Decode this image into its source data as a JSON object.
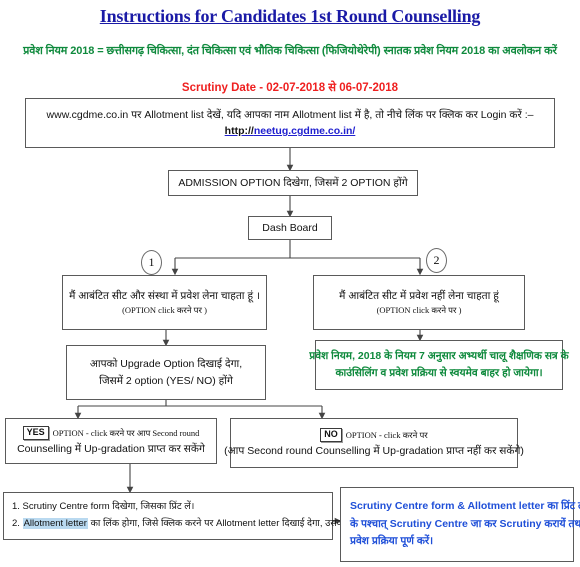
{
  "header": {
    "title": "Instructions  for Candidates 1st Round Counselling",
    "rule_line": "प्रवेश नियम 2018  = छत्तीसगढ़ चिकित्सा, दंत चिकित्सा एवं भौतिक चिकित्सा (फिजियोथेरेपी) स्नातक प्रवेश नियम 2018 का अवलोकन करें",
    "scrutiny_date": "Scrutiny Date - 02-07-2018 से 06-07-2018"
  },
  "colors": {
    "title": "#1a1aa6",
    "rule_green": "#0f8a3d",
    "scrutiny_red": "#ef2020",
    "link_blue": "#2020cf",
    "final_blue": "#1f4fd8",
    "highlight": "#b9d9f0"
  },
  "flow": {
    "allotment": {
      "line1": "www.cgdme.co.in पर Allotment list देखें, यदि आपका नाम Allotment list में है, तो नीचे लिंक पर क्लिक कर Login करें :–",
      "link_protocol": "http://",
      "link_host": "neetug.cgdme.co.in/"
    },
    "admission": {
      "text": "ADMISSION OPTION दिखेगा, जिसमें 2 OPTION होंगे"
    },
    "dashboard": {
      "text": "Dash Board"
    },
    "option1": {
      "number": "1",
      "line1": "मैं आबंटित सीट और संस्था में प्रवेश लेना चाहता हूं ।",
      "line2": "(OPTION click करने पर )"
    },
    "option2": {
      "number": "2",
      "line1": "मैं आबंटित सीट में प्रवेश नहीं लेना चाहता हूं",
      "line2": "(OPTION click करने पर )"
    },
    "upgrade": {
      "line1": "आपको Upgrade Option दिखाई देगा,",
      "line2": "जिसमें 2 option (YES/ NO) होंगे"
    },
    "rule7": {
      "line1": "प्रवेश नियम, 2018 के नियम 7 अनुसार अभ्यर्थी चालू शैक्षणिक सत्र के",
      "line2": "काउंसिलिंग व प्रवेश प्रक्रिया से स्वयमेव बाहर हो जायेगा।"
    },
    "yes_branch": {
      "badge": "YES",
      "line1_a": "OPTION - click करने पर आप Second round",
      "line2": "Counselling में Up-gradation प्राप्त कर सकेंगे"
    },
    "no_branch": {
      "badge": "NO",
      "line1_a": "OPTION - click करने पर",
      "line2": "(आप Second round Counselling में Up-gradation प्राप्त नहीं कर सकेंगे)"
    },
    "steps": {
      "step1": "1. Scrutiny Centre form दिखेगा, जिसका प्रिंट लें।",
      "step2_prefix": "2. ",
      "step2_highlight": "Allotment letter",
      "step2_rest": " का लिंक होगा, जिसे क्लिक करने पर Allotment letter दिखाई देगा, उसका प्रिंट लें।"
    },
    "final": {
      "line1": "Scrutiny Centre form & Allotment letter का प्रिंट लेने",
      "line2": "के पश्चात् Scrutiny Centre जा कर Scrutiny करायें तथा",
      "line3": "प्रवेश प्रक्रिया पूर्ण करें।"
    }
  }
}
